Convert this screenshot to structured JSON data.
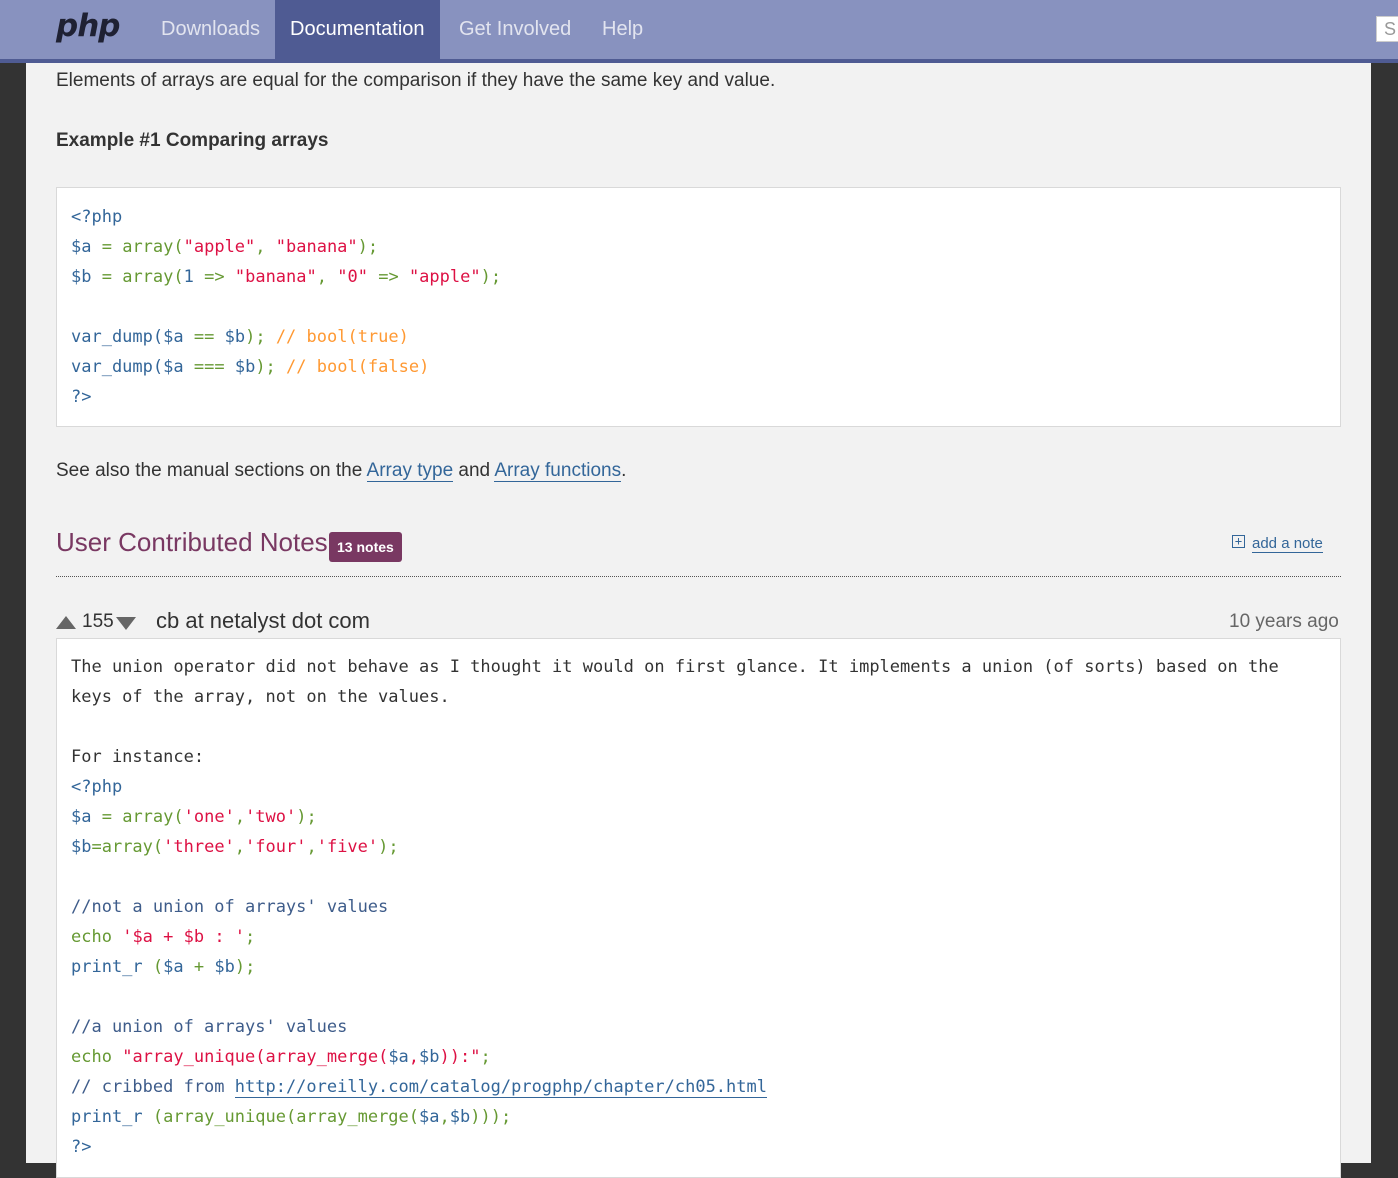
{
  "header": {
    "logo": "php",
    "nav": [
      "Downloads",
      "Documentation",
      "Get Involved",
      "Help"
    ],
    "active_nav": "Documentation",
    "search_hint": "S"
  },
  "intro_text": "Elements of arrays are equal for the comparison if they have the same key and value.",
  "example_title": "Example #1 Comparing arrays",
  "example_code": [
    "<?php",
    "$a = array(\"apple\", \"banana\");",
    "$b = array(1 => \"banana\", \"0\" => \"apple\");",
    "",
    "var_dump($a == $b); // bool(true)",
    "var_dump($a === $b); // bool(false)",
    "?>"
  ],
  "see_also": {
    "prefix": "See also the manual sections on the ",
    "link1": "Array type",
    "middle": " and ",
    "link2": "Array functions",
    "suffix": "."
  },
  "notes_section": {
    "title": "User Contributed Notes",
    "count_badge": "13 notes",
    "add_note": "add a note"
  },
  "note": {
    "votes": "155",
    "author": "cb at netalyst dot com",
    "age": "10 years ago",
    "text_line1": "The union operator did not behave as I thought it would on first glance. It implements a union (of sorts) based on the",
    "text_line2": "keys of the array, not on the values.",
    "text_line3": "For instance:",
    "code": [
      "<?php",
      "$a = array('one','two');",
      "$b=array('three','four','five');",
      "",
      "//not a union of arrays' values",
      "echo '$a + $b : ';",
      "print_r ($a + $b);",
      "",
      "//a union of arrays' values",
      "echo \"array_unique(array_merge($a,$b)):\";",
      "// cribbed from http://oreilly.com/catalog/progphp/chapter/ch05.html",
      "print_r (array_unique(array_merge($a,$b)));",
      "?>"
    ],
    "cribbed_prefix": "// cribbed from ",
    "cribbed_link": "http://oreilly.com/catalog/progphp/chapter/ch05.html"
  }
}
